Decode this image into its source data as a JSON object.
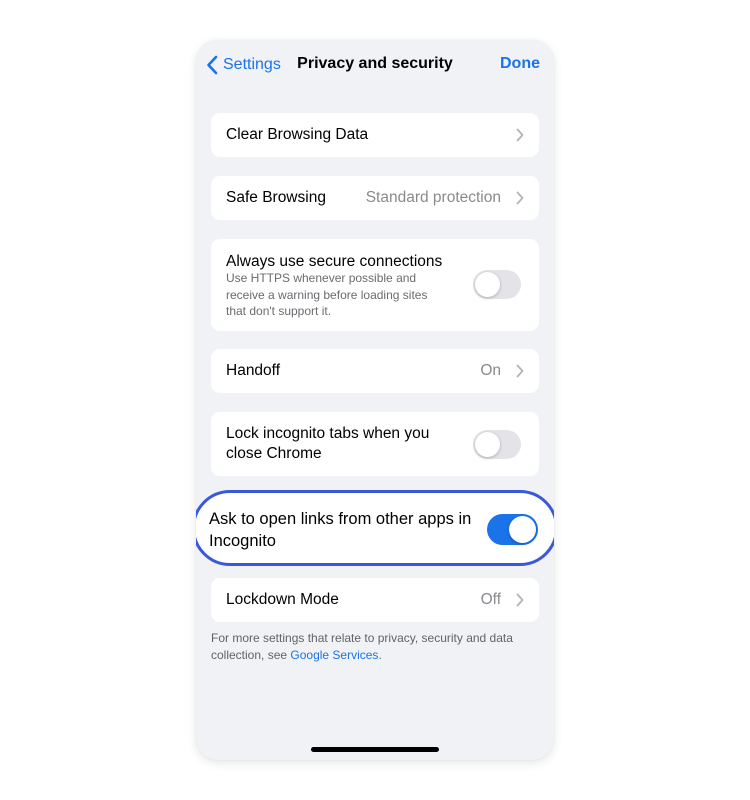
{
  "nav": {
    "back_label": "Settings",
    "title": "Privacy and security",
    "done_label": "Done"
  },
  "rows": {
    "clear_browsing": {
      "label": "Clear Browsing Data"
    },
    "safe_browsing": {
      "label": "Safe Browsing",
      "value": "Standard protection"
    },
    "secure_connections": {
      "label": "Always use secure connections",
      "sublabel": "Use HTTPS whenever possible and receive a warning before loading sites that don't support it.",
      "toggle_on": false
    },
    "handoff": {
      "label": "Handoff",
      "value": "On"
    },
    "lock_incognito": {
      "label": "Lock incognito tabs when you close Chrome",
      "toggle_on": false
    },
    "ask_incognito": {
      "label": "Ask to open links from other apps in Incognito",
      "toggle_on": true
    },
    "lockdown": {
      "label": "Lockdown Mode",
      "value": "Off"
    }
  },
  "footer": {
    "text": "For more settings that relate to privacy, security and data collection, see ",
    "link": "Google Services",
    "suffix": "."
  },
  "colors": {
    "accent": "#1a73e8",
    "highlight_border": "#3a59d8",
    "background": "#f1f2f5",
    "toggle_off": "#e4e4e8"
  },
  "icons": {
    "back": "chevron-left-icon",
    "row_disclosure": "chevron-right-icon"
  }
}
